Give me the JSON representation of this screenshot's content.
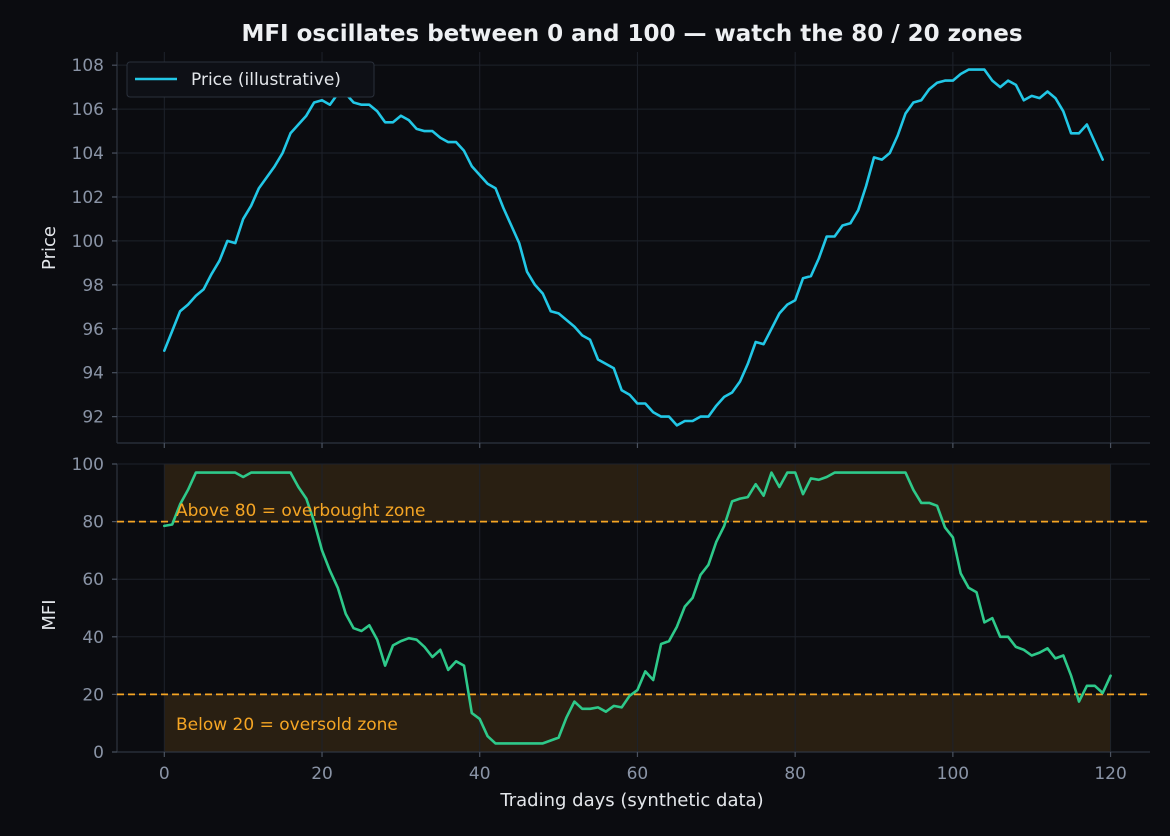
{
  "chart_data": {
    "title": "MFI oscillates between 0 and 100 — watch the 80 / 20 zones",
    "xlabel": "Trading days (synthetic data)",
    "x_ticks": [
      0,
      20,
      40,
      60,
      80,
      100,
      120
    ],
    "xlim": [
      -6,
      125
    ],
    "panels": [
      {
        "type": "line",
        "ylabel": "Price",
        "ylim": [
          90.8,
          108.6
        ],
        "y_ticks": [
          92,
          94,
          96,
          98,
          100,
          102,
          104,
          106,
          108
        ],
        "grid": true,
        "legend": {
          "placement": "top-left"
        },
        "series": [
          {
            "name": "Price (illustrative)",
            "color": "#22c7e6",
            "x_start": 0,
            "x_step": 1,
            "values": [
              95.0,
              95.9,
              96.8,
              97.1,
              97.5,
              97.8,
              98.5,
              99.1,
              100.0,
              99.9,
              101.0,
              101.6,
              102.4,
              102.9,
              103.4,
              104.0,
              104.9,
              105.3,
              105.7,
              106.3,
              106.4,
              106.2,
              106.7,
              106.7,
              106.3,
              106.2,
              106.2,
              105.9,
              105.4,
              105.4,
              105.7,
              105.5,
              105.1,
              105.0,
              105.0,
              104.7,
              104.5,
              104.5,
              104.1,
              103.4,
              103.0,
              102.6,
              102.4,
              101.5,
              100.7,
              99.9,
              98.6,
              98.0,
              97.6,
              96.8,
              96.7,
              96.4,
              96.1,
              95.7,
              95.5,
              94.6,
              94.4,
              94.2,
              93.2,
              93.0,
              92.6,
              92.6,
              92.2,
              92.0,
              92.0,
              91.6,
              91.8,
              91.8,
              92.0,
              92.0,
              92.5,
              92.9,
              93.1,
              93.6,
              94.4,
              95.4,
              95.3,
              96.0,
              96.7,
              97.1,
              97.3,
              98.3,
              98.4,
              99.2,
              100.2,
              100.2,
              100.7,
              100.8,
              101.4,
              102.5,
              103.8,
              103.7,
              104.0,
              104.8,
              105.8,
              106.3,
              106.4,
              106.9,
              107.2,
              107.3,
              107.3,
              107.6,
              107.8,
              107.8,
              107.8,
              107.3,
              107.0,
              107.3,
              107.1,
              106.4,
              106.6,
              106.5,
              106.8,
              106.5,
              105.9,
              104.9,
              104.9,
              105.3,
              104.5,
              103.7
            ]
          }
        ]
      },
      {
        "type": "line",
        "ylabel": "MFI",
        "ylim": [
          0,
          100
        ],
        "y_ticks": [
          0,
          20,
          40,
          60,
          80,
          100
        ],
        "grid": true,
        "zones": [
          {
            "from": 80,
            "to": 100,
            "label": "Above 80 = overbought zone",
            "color": "#f5a524"
          },
          {
            "from": 0,
            "to": 20,
            "label": "Below 20 = oversold zone",
            "color": "#f5a524"
          }
        ],
        "reference_lines": [
          80,
          20
        ],
        "series": [
          {
            "color": "#2ec98a",
            "x_start": 0,
            "x_step": 1,
            "values": [
              78.5,
              79.0,
              86.0,
              91.0,
              97.0,
              97.0,
              97.0,
              97.0,
              97.0,
              97.0,
              95.5,
              97.0,
              97.0,
              97.0,
              97.0,
              97.0,
              97.0,
              92.0,
              88.0,
              80.0,
              70.0,
              63.0,
              57.0,
              48.0,
              43.0,
              42.0,
              44.0,
              39.0,
              30.0,
              37.0,
              38.5,
              39.5,
              39.0,
              36.5,
              33.0,
              35.5,
              28.5,
              31.5,
              30.0,
              13.5,
              11.5,
              5.5,
              3.0,
              3.0,
              3.0,
              3.0,
              3.0,
              3.0,
              3.0,
              4.0,
              5.0,
              12.0,
              17.5,
              15.0,
              15.0,
              15.5,
              14.0,
              16.0,
              15.5,
              19.5,
              21.5,
              28.0,
              25.0,
              37.5,
              38.5,
              43.5,
              50.5,
              53.5,
              61.5,
              65.0,
              73.0,
              78.5,
              87.0,
              88.0,
              88.5,
              93.0,
              89.0,
              97.0,
              92.0,
              97.0,
              97.0,
              89.5,
              95.0,
              94.5,
              95.5,
              97.0,
              97.0,
              97.0,
              97.0,
              97.0,
              97.0,
              97.0,
              97.0,
              97.0,
              97.0,
              91.0,
              86.5,
              86.5,
              85.5,
              78.0,
              74.5,
              62.0,
              57.0,
              55.5,
              45.0,
              46.5,
              40.0,
              40.0,
              36.5,
              35.5,
              33.5,
              34.5,
              36.0,
              32.5,
              33.5,
              26.5,
              17.5,
              23.0,
              23.0,
              20.5,
              26.5
            ]
          }
        ]
      }
    ]
  }
}
